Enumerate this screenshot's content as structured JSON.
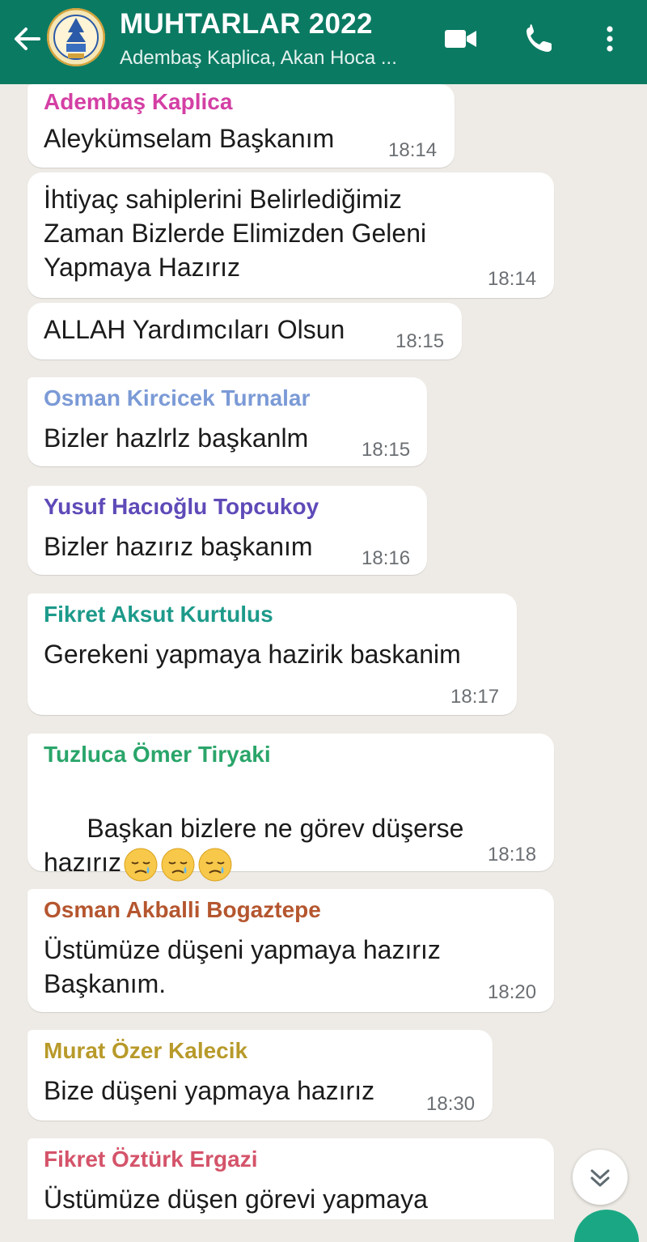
{
  "header": {
    "title": "MUHTARLAR 2022",
    "subtitle": "Adembaş Kaplica, Akan Hoca ...",
    "icons": [
      "back-arrow-icon",
      "group-avatar",
      "video-call-icon",
      "voice-call-icon",
      "more-options-icon"
    ],
    "background": "#0b7a63"
  },
  "messages": [
    {
      "sender": "Adembaş Kaplica",
      "sender_color": "#d43fa4",
      "text": "Aleykümselam Başkanım",
      "time": "18:14"
    },
    {
      "sender": "",
      "text": "İhtiyaç sahiplerini Belirlediğimiz\nZaman Bizlerde Elimizden Geleni\nYapmaya Hazırız",
      "time": "18:14"
    },
    {
      "sender": "",
      "text": "ALLAH Yardımcıları Olsun",
      "time": "18:15"
    },
    {
      "sender": "Osman Kircicek Turnalar",
      "sender_color": "#7b9ad6",
      "text": "Bizler hazlrlz başkanlm",
      "time": "18:15"
    },
    {
      "sender": "Yusuf Hacıoğlu Topcukoy",
      "sender_color": "#5f4ab8",
      "text": "Bizler hazırız başkanım",
      "time": "18:16"
    },
    {
      "sender": "Fikret Aksut Kurtulus",
      "sender_color": "#1d9a8a",
      "text": "Gerekeni yapmaya hazirik baskanim",
      "time": "18:17"
    },
    {
      "sender": "Tuzluca Ömer Tiryaki",
      "sender_color": "#2aa56a",
      "text": "Başkan bizlere ne görev düşerse\nhazırız",
      "time": "18:18",
      "emoji_count": 3
    },
    {
      "sender": "Osman Akballi Bogaztepe",
      "sender_color": "#b5562f",
      "text": "Üstümüze düşeni yapmaya hazırız\nBaşkanım.",
      "time": "18:20"
    },
    {
      "sender": "Murat Özer Kalecik",
      "sender_color": "#b89a2a",
      "text": "Bize düşeni yapmaya hazırız",
      "time": "18:30"
    },
    {
      "sender": "Fikret Öztürk Ergazi",
      "sender_color": "#d4546a",
      "text": "Üstümüze düşen görevi yapmaya",
      "time": ""
    }
  ],
  "scroll_button": {
    "icon": "double-chevron-down-icon"
  },
  "colors": {
    "chat_bg": "#eeebe6",
    "bubble": "#ffffff",
    "time": "#6b6f73"
  }
}
